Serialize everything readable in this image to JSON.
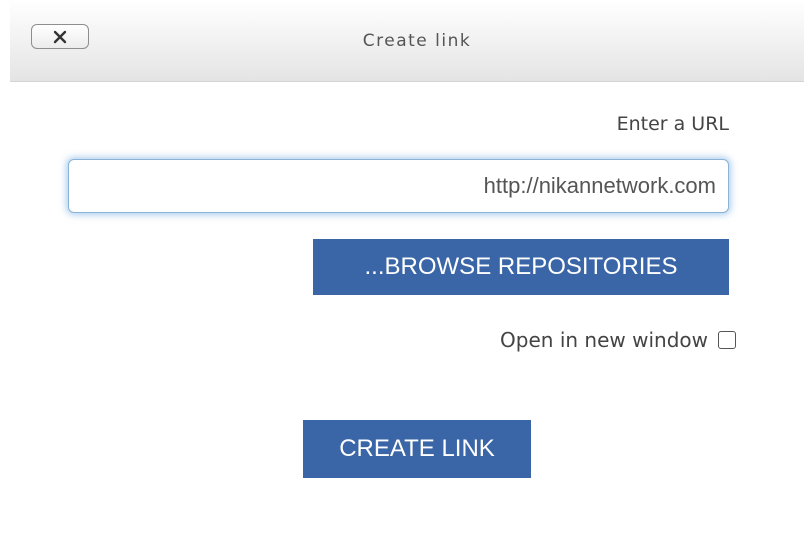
{
  "dialog": {
    "title": "Create link",
    "close_icon": "close-x-icon"
  },
  "url_field": {
    "label": "Enter a URL",
    "value": "http://nikannetwork.com"
  },
  "browse_button": {
    "label": "...BROWSE REPOSITORIES"
  },
  "new_window": {
    "label": "Open in new window",
    "checked": false
  },
  "create_button": {
    "label": "CREATE LINK"
  },
  "colors": {
    "button_bg": "#3a66a7",
    "button_text": "#ffffff",
    "input_focus_glow": "#70aae0"
  }
}
